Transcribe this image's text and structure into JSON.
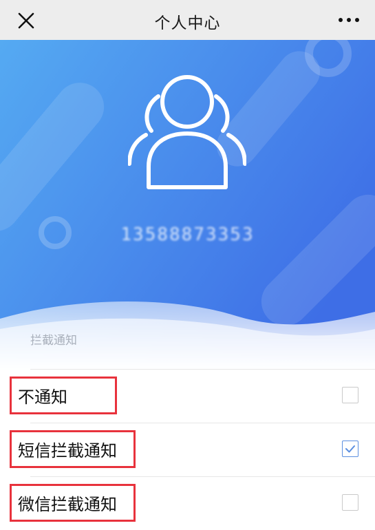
{
  "topbar": {
    "title": "个人中心",
    "close_icon": "close-icon",
    "more_icon": "more-dots-icon"
  },
  "profile": {
    "avatar_icon": "user-group-icon",
    "phone": "13588873353"
  },
  "notification": {
    "section_title": "拦截通知",
    "options": [
      {
        "label": "不通知",
        "checked": false
      },
      {
        "label": "短信拦截通知",
        "checked": true
      },
      {
        "label": "微信拦截通知",
        "checked": false
      }
    ]
  },
  "colors": {
    "hero_blue_left": "#52a6f0",
    "hero_blue_right": "#3f6fe6",
    "highlight_red": "#e8323c",
    "check_blue": "#5b8fe0"
  }
}
